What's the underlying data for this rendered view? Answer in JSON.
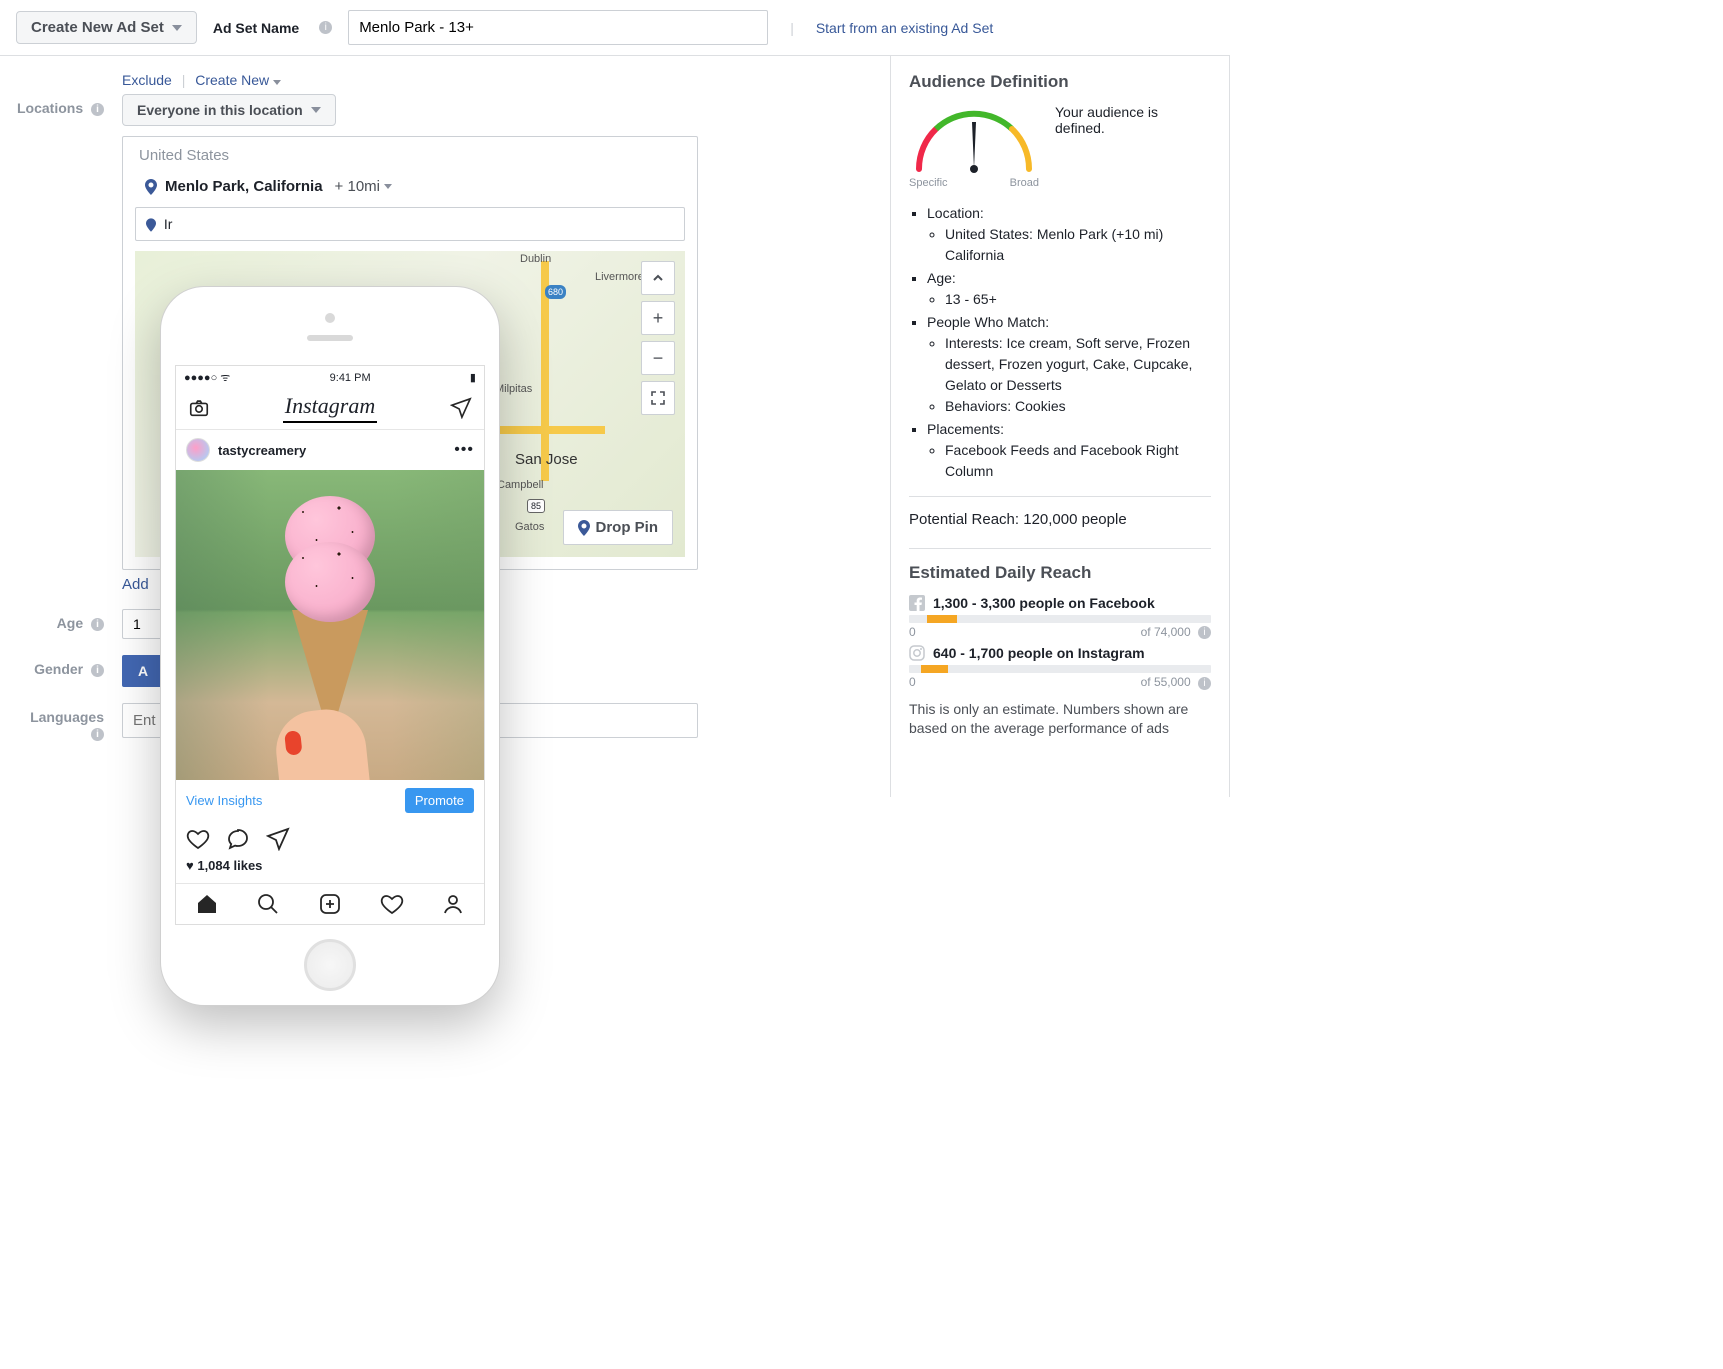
{
  "topBar": {
    "createButton": "Create New Ad Set",
    "nameLabel": "Ad Set Name",
    "nameValue": "Menlo Park - 13+",
    "startLink": "Start from an existing Ad Set"
  },
  "links": {
    "exclude": "Exclude",
    "createNew": "Create New"
  },
  "labels": {
    "locations": "Locations",
    "age": "Age",
    "gender": "Gender",
    "languages": "Languages"
  },
  "locations": {
    "scopeButton": "Everyone in this location",
    "country": "United States",
    "place": "Menlo Park, California",
    "radius": "+ 10mi",
    "searchPrefix": "Ir",
    "addLink": "Add",
    "dropPin": "Drop Pin",
    "mapCities": {
      "dublin": "Dublin",
      "livermore": "Livermore",
      "milpitas": "Milpitas",
      "sanJose": "San Jose",
      "campbell": "Campbell",
      "gatos": "Gatos"
    }
  },
  "age": {
    "value": "1"
  },
  "gender": {
    "allButton": "A"
  },
  "languages": {
    "placeholder": "Ent"
  },
  "audience": {
    "title": "Audience Definition",
    "status": "Your audience is defined.",
    "specific": "Specific",
    "broad": "Broad",
    "items": {
      "locationLabel": "Location:",
      "locationDetail": "United States: Menlo Park (+10 mi) California",
      "ageLabel": "Age:",
      "ageDetail": "13 - 65+",
      "matchLabel": "People Who Match:",
      "interests": "Interests: Ice cream, Soft serve, Frozen dessert, Frozen yogurt, Cake, Cupcake, Gelato or Desserts",
      "behaviors": "Behaviors: Cookies",
      "placementsLabel": "Placements:",
      "placementsDetail": "Facebook Feeds and Facebook Right Column"
    },
    "potentialReach": "Potential Reach: 120,000 people"
  },
  "dailyReach": {
    "title": "Estimated Daily Reach",
    "fb": "1,300 - 3,300 people on Facebook",
    "fbMin": "0",
    "fbMax": "of 74,000",
    "ig": "640 - 1,700 people on Instagram",
    "igMin": "0",
    "igMax": "of 55,000",
    "disclaimer": "This is only an estimate. Numbers shown are based on the average performance of ads"
  },
  "instagram": {
    "time": "9:41 PM",
    "logo": "Instagram",
    "username": "tastycreamery",
    "viewInsights": "View Insights",
    "promote": "Promote",
    "likes": "1,084 likes"
  }
}
